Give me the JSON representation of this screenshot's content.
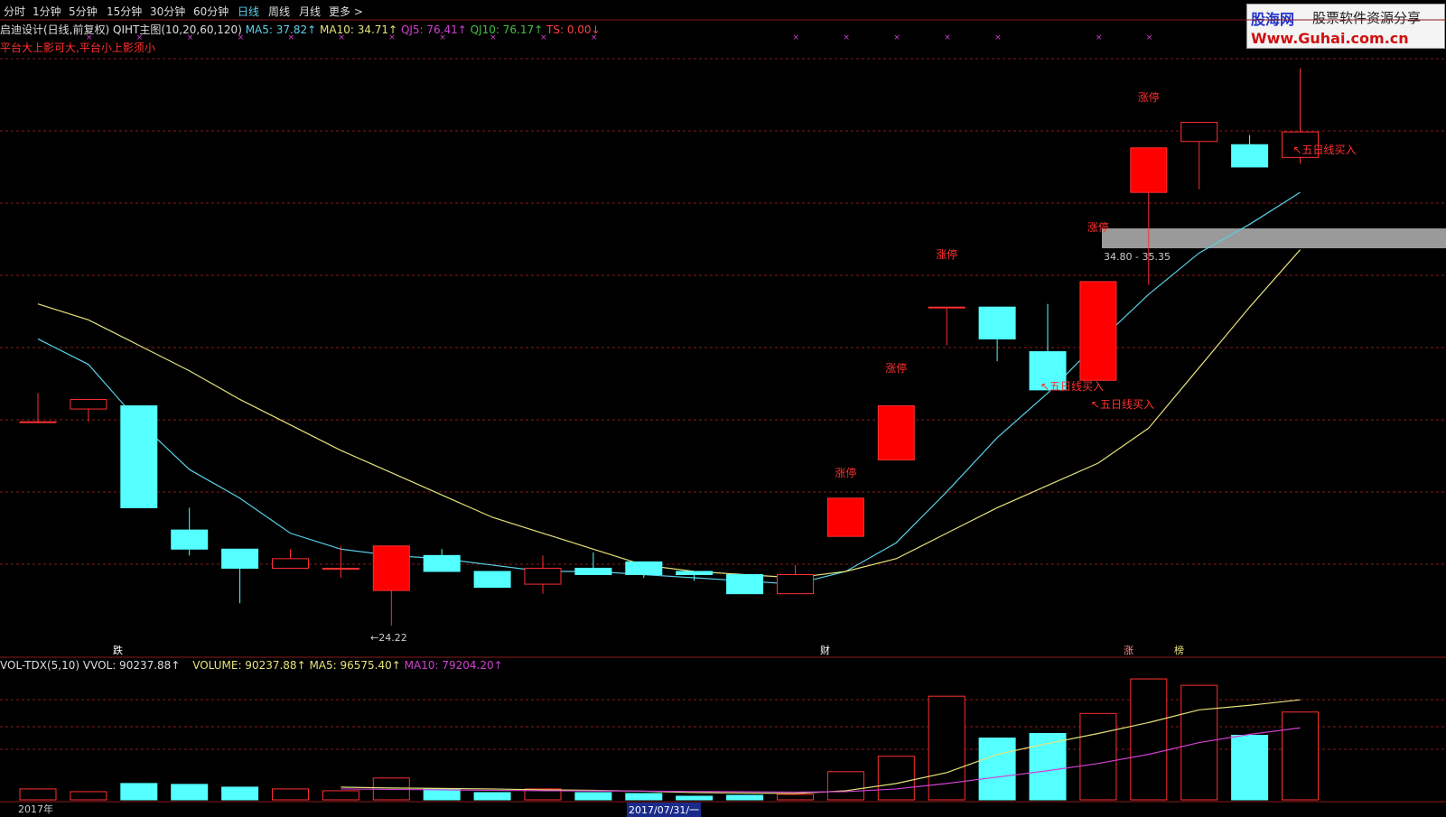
{
  "toolbar": {
    "tabs": [
      {
        "label": "分时",
        "active": false
      },
      {
        "label": "1分钟",
        "active": false
      },
      {
        "label": "5分钟",
        "active": false
      },
      {
        "label": "15分钟",
        "active": false
      },
      {
        "label": "30分钟",
        "active": false
      },
      {
        "label": "60分钟",
        "active": false
      },
      {
        "label": "日线",
        "active": true
      },
      {
        "label": "周线",
        "active": false
      },
      {
        "label": "月线",
        "active": false
      },
      {
        "label": "更多 >",
        "active": false
      }
    ]
  },
  "main_header": {
    "title": "启迪设计(日线,前复权)",
    "indicator": "QIHT主图(10,20,60,120)",
    "ma5": "MA5: 37.82↑",
    "ma10": "MA10: 34.71↑",
    "qj5": "QJ5: 76.41↑",
    "qj10": "QJ10: 76.17↑",
    "ts": "TS: 0.00↓",
    "note": "平台大上影可大,平台小上影须小"
  },
  "logo": {
    "line1a": "股海网",
    "line1b": "股票软件资源分享",
    "line2": "Www.Guhai.com.cn"
  },
  "annotations": {
    "zt": "涨停",
    "buy": "↖五日线买入",
    "low_marker": "←24.22",
    "zone_label": "34.80 - 35.35",
    "tag_die": "跌",
    "tag_cai": "财",
    "tag_zhang": "涨",
    "tag_bang": "榜"
  },
  "vol_header": {
    "name": "VOL-TDX(5,10)",
    "vvol": "VVOL: 90237.88↑",
    "volume": "VOLUME: 90237.88↑",
    "ma5": "MA5: 96575.40↑",
    "ma10": "MA10: 79204.20↑"
  },
  "bottom": {
    "year": "2017年",
    "date": "2017/07/31/一"
  },
  "colors": {
    "up": "#ff3030",
    "upfill": "#ff0000",
    "down": "#54ffff",
    "ma5": "#5ad0e8",
    "ma10": "#e6e27a",
    "grid": "#8b1a1a",
    "vma5": "#e6e27a",
    "vma10": "#d040d0"
  },
  "chart_data": {
    "type": "candlestick",
    "price_range": [
      24,
      42
    ],
    "candles": [
      {
        "o": 30.6,
        "h": 31.5,
        "l": 30.6,
        "c": 30.6
      },
      {
        "o": 31.0,
        "h": 31.2,
        "l": 30.6,
        "c": 31.3
      },
      {
        "o": 31.1,
        "h": 31.1,
        "l": 27.9,
        "c": 27.9
      },
      {
        "o": 27.2,
        "h": 27.9,
        "l": 26.4,
        "c": 26.6
      },
      {
        "o": 26.6,
        "h": 26.6,
        "l": 24.9,
        "c": 26.0
      },
      {
        "o": 26.0,
        "h": 26.6,
        "l": 26.0,
        "c": 26.3
      },
      {
        "o": 26.0,
        "h": 26.7,
        "l": 25.7,
        "c": 26.0
      },
      {
        "o": 25.3,
        "h": 26.7,
        "l": 24.2,
        "c": 26.7
      },
      {
        "o": 26.4,
        "h": 26.6,
        "l": 25.9,
        "c": 25.9
      },
      {
        "o": 25.9,
        "h": 25.9,
        "l": 25.4,
        "c": 25.4
      },
      {
        "o": 25.5,
        "h": 26.4,
        "l": 25.2,
        "c": 26.0
      },
      {
        "o": 26.0,
        "h": 26.5,
        "l": 25.8,
        "c": 25.8
      },
      {
        "o": 26.2,
        "h": 26.2,
        "l": 25.7,
        "c": 25.8
      },
      {
        "o": 25.9,
        "h": 25.9,
        "l": 25.6,
        "c": 25.8
      },
      {
        "o": 25.8,
        "h": 25.8,
        "l": 25.2,
        "c": 25.2
      },
      {
        "o": 25.2,
        "h": 26.1,
        "l": 25.2,
        "c": 25.8
      },
      {
        "o": 27.0,
        "h": 27.0,
        "l": 27.0,
        "c": 28.2
      },
      {
        "o": 29.4,
        "h": 31.1,
        "l": 29.4,
        "c": 31.1
      },
      {
        "o": 34.2,
        "h": 34.2,
        "l": 33.0,
        "c": 34.2
      },
      {
        "o": 34.2,
        "h": 34.2,
        "l": 32.5,
        "c": 33.2
      },
      {
        "o": 32.8,
        "h": 34.3,
        "l": 31.9,
        "c": 31.6
      },
      {
        "o": 31.9,
        "h": 35.0,
        "l": 31.9,
        "c": 35.0
      },
      {
        "o": 37.8,
        "h": 39.2,
        "l": 34.9,
        "c": 39.2
      },
      {
        "o": 39.4,
        "h": 40.0,
        "l": 37.9,
        "c": 40.0
      },
      {
        "o": 39.3,
        "h": 39.6,
        "l": 38.6,
        "c": 38.6
      },
      {
        "o": 38.9,
        "h": 41.7,
        "l": 38.7,
        "c": 39.7
      }
    ],
    "ma5": [
      33.2,
      32.4,
      30.6,
      29.1,
      28.2,
      27.1,
      26.6,
      26.4,
      26.3,
      26.1,
      25.9,
      25.9,
      25.8,
      25.7,
      25.6,
      25.5,
      25.9,
      26.8,
      28.4,
      30.1,
      31.5,
      33.1,
      34.6,
      35.9,
      36.8,
      37.8
    ],
    "ma10": [
      34.3,
      33.8,
      33.0,
      32.2,
      31.3,
      30.5,
      29.7,
      29.0,
      28.3,
      27.6,
      27.1,
      26.6,
      26.1,
      25.9,
      25.8,
      25.7,
      25.9,
      26.3,
      27.1,
      27.9,
      28.6,
      29.3,
      30.4,
      32.3,
      34.2,
      36.0
    ],
    "volume": [
      12000,
      9000,
      18000,
      17000,
      14000,
      12000,
      10000,
      24000,
      12000,
      8000,
      12000,
      8000,
      7000,
      4000,
      5000,
      6000,
      31000,
      48000,
      114000,
      68000,
      73000,
      95000,
      133000,
      126000,
      71000,
      96575
    ],
    "vol_ma5": [
      null,
      null,
      null,
      null,
      null,
      null,
      14000,
      13000,
      12500,
      12000,
      11000,
      10500,
      9500,
      8000,
      7500,
      7000,
      10000,
      18000,
      30000,
      50000,
      62000,
      73000,
      85000,
      99000,
      104000,
      110000
    ],
    "vol_ma10": [
      null,
      null,
      null,
      null,
      null,
      null,
      12000,
      11500,
      11000,
      10500,
      10000,
      9800,
      9600,
      9200,
      8900,
      8500,
      9000,
      12000,
      18000,
      25000,
      32000,
      40000,
      50000,
      63000,
      72000,
      79204
    ]
  }
}
